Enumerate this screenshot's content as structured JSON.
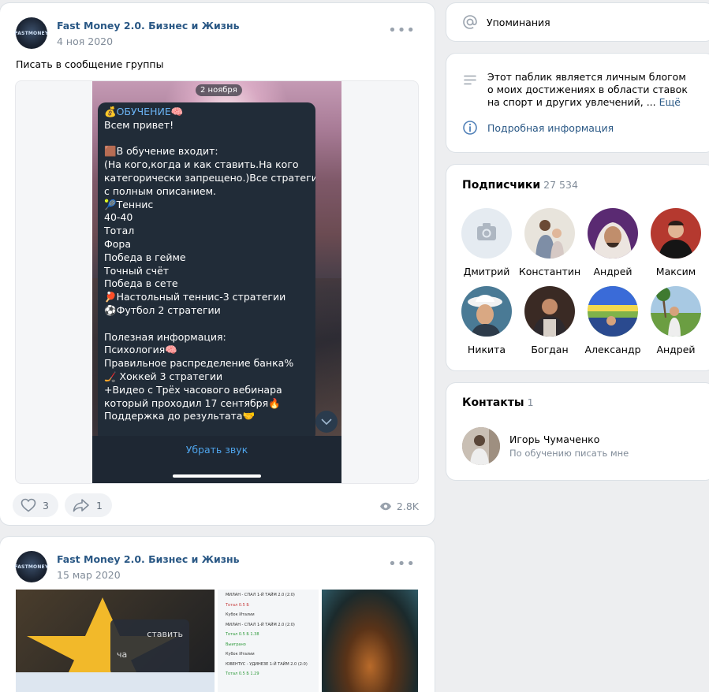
{
  "posts": [
    {
      "author": "Fast Money 2.0. Бизнес и Жизнь",
      "date": "4 ноя 2020",
      "logo_text": "FASTMONEY",
      "text": "Писать в сообщение группы",
      "media": {
        "date_pill": "2 ноября",
        "message_title": "💰ОБУЧЕНИЕ🧠",
        "message_lines": [
          "Всем привет!",
          "",
          "🟫В обучение входит:",
          "(На кого,когда и как ставить.На кого",
          "категорически запрещено.)Все стратегии",
          "с полным описанием.",
          "🎾Теннис",
          "40-40",
          "Тотал",
          "Фора",
          "Победа в гейме",
          "Точный счёт",
          "Победа в сете",
          "🏓Настольный теннис-3 стратегии",
          "⚽Футбол 2 стратегии",
          "",
          "Полезная информация:",
          "Психология🧠",
          "Правильное распределение банка%",
          "🏒 Хоккей 3 стратегии",
          "+Видео с Трёх часового вебинара",
          "который проходил 17 сентября🔥",
          "Поддержка до результата🤝"
        ],
        "mute_label": "Убрать звук"
      },
      "likes": "3",
      "shares": "1",
      "views": "2.8K"
    },
    {
      "author": "Fast Money 2.0. Бизнес и Жизнь",
      "date": "15 мар 2020",
      "logo_text": "FASTMONEY",
      "thumb1_lines": [
        "ставить",
        "ча"
      ],
      "thumb2_lines": [
        {
          "t": "МИЛАН - СПАЛ 1-Й ТАЙМ 2.0 (2:0)",
          "c": ""
        },
        {
          "t": "Тотал 0.5 Б",
          "c": "r"
        },
        {
          "t": "Кубок Италии",
          "c": ""
        },
        {
          "t": "МИЛАН - СПАЛ 1-Й ТАЙМ 2.0 (2:0)",
          "c": ""
        },
        {
          "t": "Тотал 0.5 Б       1.38",
          "c": "g"
        },
        {
          "t": "Выиграно",
          "c": "g"
        },
        {
          "t": "Кубок Италии",
          "c": ""
        },
        {
          "t": "ЮВЕНТУС - УДИНЕЗЕ 1-Й ТАЙМ 2.0 (2:0)",
          "c": ""
        },
        {
          "t": "Тотал 0.5 Б       1.29",
          "c": "g"
        }
      ]
    }
  ],
  "sidebar": {
    "mentions_label": "Упоминания",
    "about_text": "Этот паблик является личным блогом о моих достижениях в области ставок на спорт и других увлечений, ...",
    "about_more": "Ещё",
    "detail_link": "Подробная информация",
    "subscribers_title": "Подписчики",
    "subscribers_count": "27 534",
    "subscribers": [
      {
        "name": "Дмитрий",
        "photo": "none"
      },
      {
        "name": "Константин",
        "photo": "family"
      },
      {
        "name": "Андрей",
        "photo": "purple"
      },
      {
        "name": "Максим",
        "photo": "red"
      },
      {
        "name": "Никита",
        "photo": "hat"
      },
      {
        "name": "Богдан",
        "photo": "dark"
      },
      {
        "name": "Александр",
        "photo": "stadium"
      },
      {
        "name": "Андрей",
        "photo": "palm"
      }
    ],
    "contacts_title": "Контакты",
    "contacts_count": "1",
    "contact_name": "Игорь Чумаченко",
    "contact_note": "По обучению писать мне"
  },
  "colors": {
    "link": "#2a5885",
    "muted": "#818c99",
    "background": "#edeef0"
  }
}
